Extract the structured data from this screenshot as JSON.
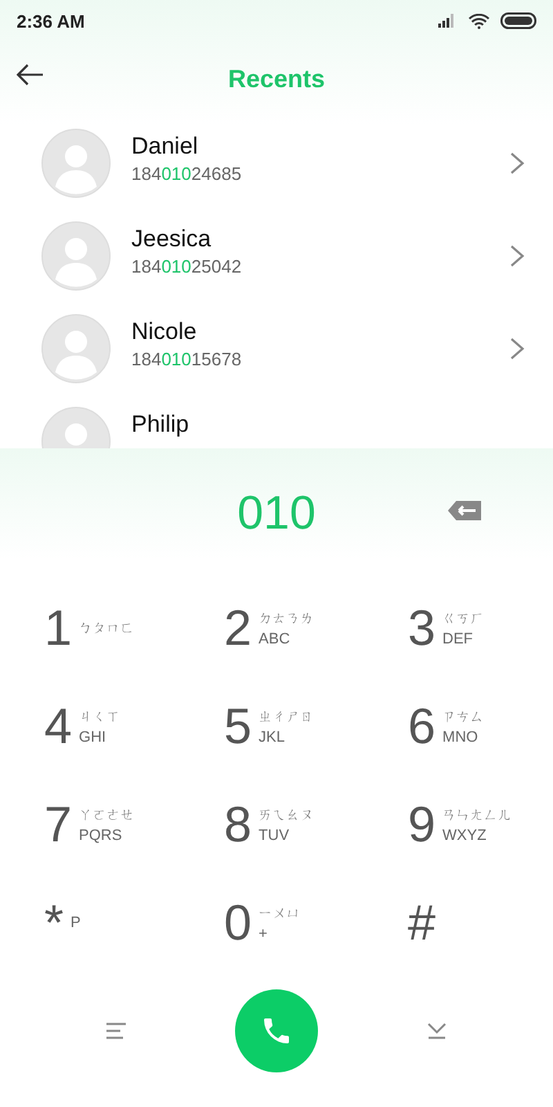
{
  "status_bar": {
    "time": "2:36 AM"
  },
  "header": {
    "title": "Recents"
  },
  "contacts": [
    {
      "name": "Daniel",
      "number": [
        "184",
        "010",
        "24685"
      ]
    },
    {
      "name": "Jeesica",
      "number": [
        "184",
        "010",
        "25042"
      ]
    },
    {
      "name": "Nicole",
      "number": [
        "184",
        "010",
        "15678"
      ]
    },
    {
      "name": "Philip"
    }
  ],
  "dialed": "010",
  "keys": [
    {
      "digit": "1",
      "bopomofo": "ㄅㄆㄇㄈ"
    },
    {
      "digit": "2",
      "bopomofo": "ㄉㄊㄋㄌ",
      "letters": "ABC"
    },
    {
      "digit": "3",
      "bopomofo": "ㄍㄎㄏ",
      "letters": "DEF"
    },
    {
      "digit": "4",
      "bopomofo": "ㄐㄑㄒ",
      "letters": "GHI"
    },
    {
      "digit": "5",
      "bopomofo": "ㄓㄔㄕㄖ",
      "letters": "JKL"
    },
    {
      "digit": "6",
      "bopomofo": "ㄗㄘㄙ",
      "letters": "MNO"
    },
    {
      "digit": "7",
      "bopomofo": "ㄚㄛㄜㄝ",
      "letters": "PQRS"
    },
    {
      "digit": "8",
      "bopomofo": "ㄞㄟㄠㄡ",
      "letters": "TUV"
    },
    {
      "digit": "9",
      "bopomofo": "ㄢㄣㄤㄥㄦ",
      "letters": "WXYZ"
    },
    {
      "digit": "*",
      "letters": "P"
    },
    {
      "digit": "0",
      "bopomofo": "ㄧㄨㄩ",
      "letters": "+"
    },
    {
      "digit": "#"
    }
  ]
}
